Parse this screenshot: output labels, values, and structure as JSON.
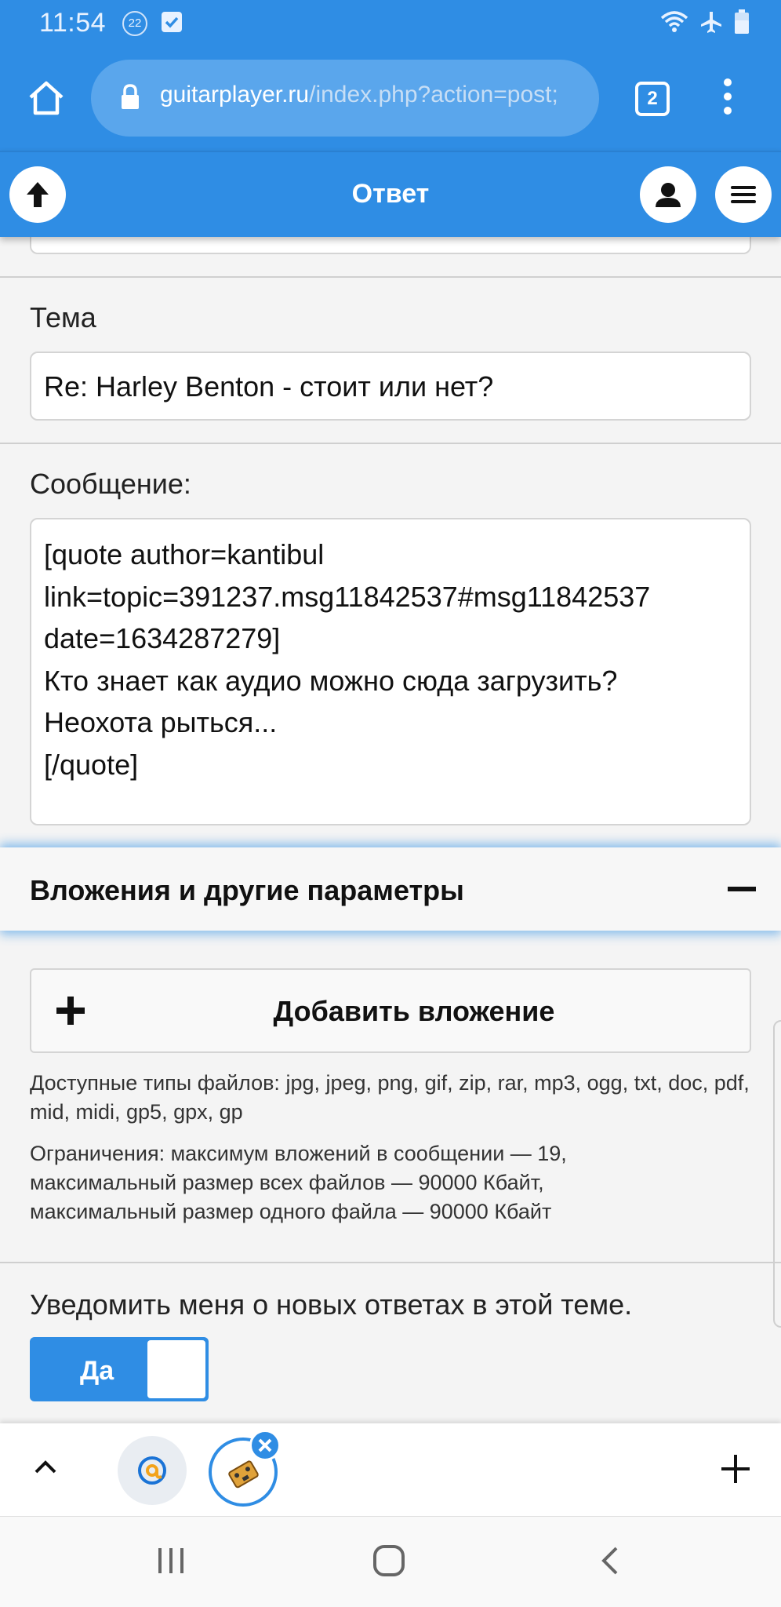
{
  "status_bar": {
    "time": "11:54",
    "notification_count": "22",
    "icons": [
      "wifi-icon",
      "airplane-icon",
      "battery-icon"
    ]
  },
  "browser": {
    "url_domain": "guitarplayer.ru",
    "url_path": "/index.php?action=post;",
    "tab_count": "2"
  },
  "header": {
    "title": "Ответ"
  },
  "form": {
    "subject_label": "Тема",
    "subject_value": "Re: Harley Benton - стоит или нет?",
    "message_label": "Сообщение:",
    "message_value": "[quote author=kantibul\nlink=topic=391237.msg11842537#msg11842537\ndate=1634287279]\nКто знает как аудио можно сюда загрузить?\nНеохота рыться...\n[/quote]"
  },
  "attachments": {
    "section_title": "Вложения и другие параметры",
    "add_button": "Добавить вложение",
    "allowed_types": "Доступные типы файлов: jpg, jpeg, png, gif, zip, rar, mp3, ogg, txt, doc, pdf, mid, midi, gp5, gpx, gp",
    "limits_line1": "Ограничения: максимум вложений в сообщении — 19,",
    "limits_line2": "максимальный размер всех файлов — 90000 Кбайт,",
    "limits_line3": "максимальный размер одного файла — 90000 Кбайт"
  },
  "notify": {
    "label": "Уведомить меня о новых ответах в этой теме.",
    "toggle_label": "Да",
    "toggle_on": true
  },
  "colors": {
    "accent": "#2f8de4",
    "background": "#f4f4f4"
  }
}
